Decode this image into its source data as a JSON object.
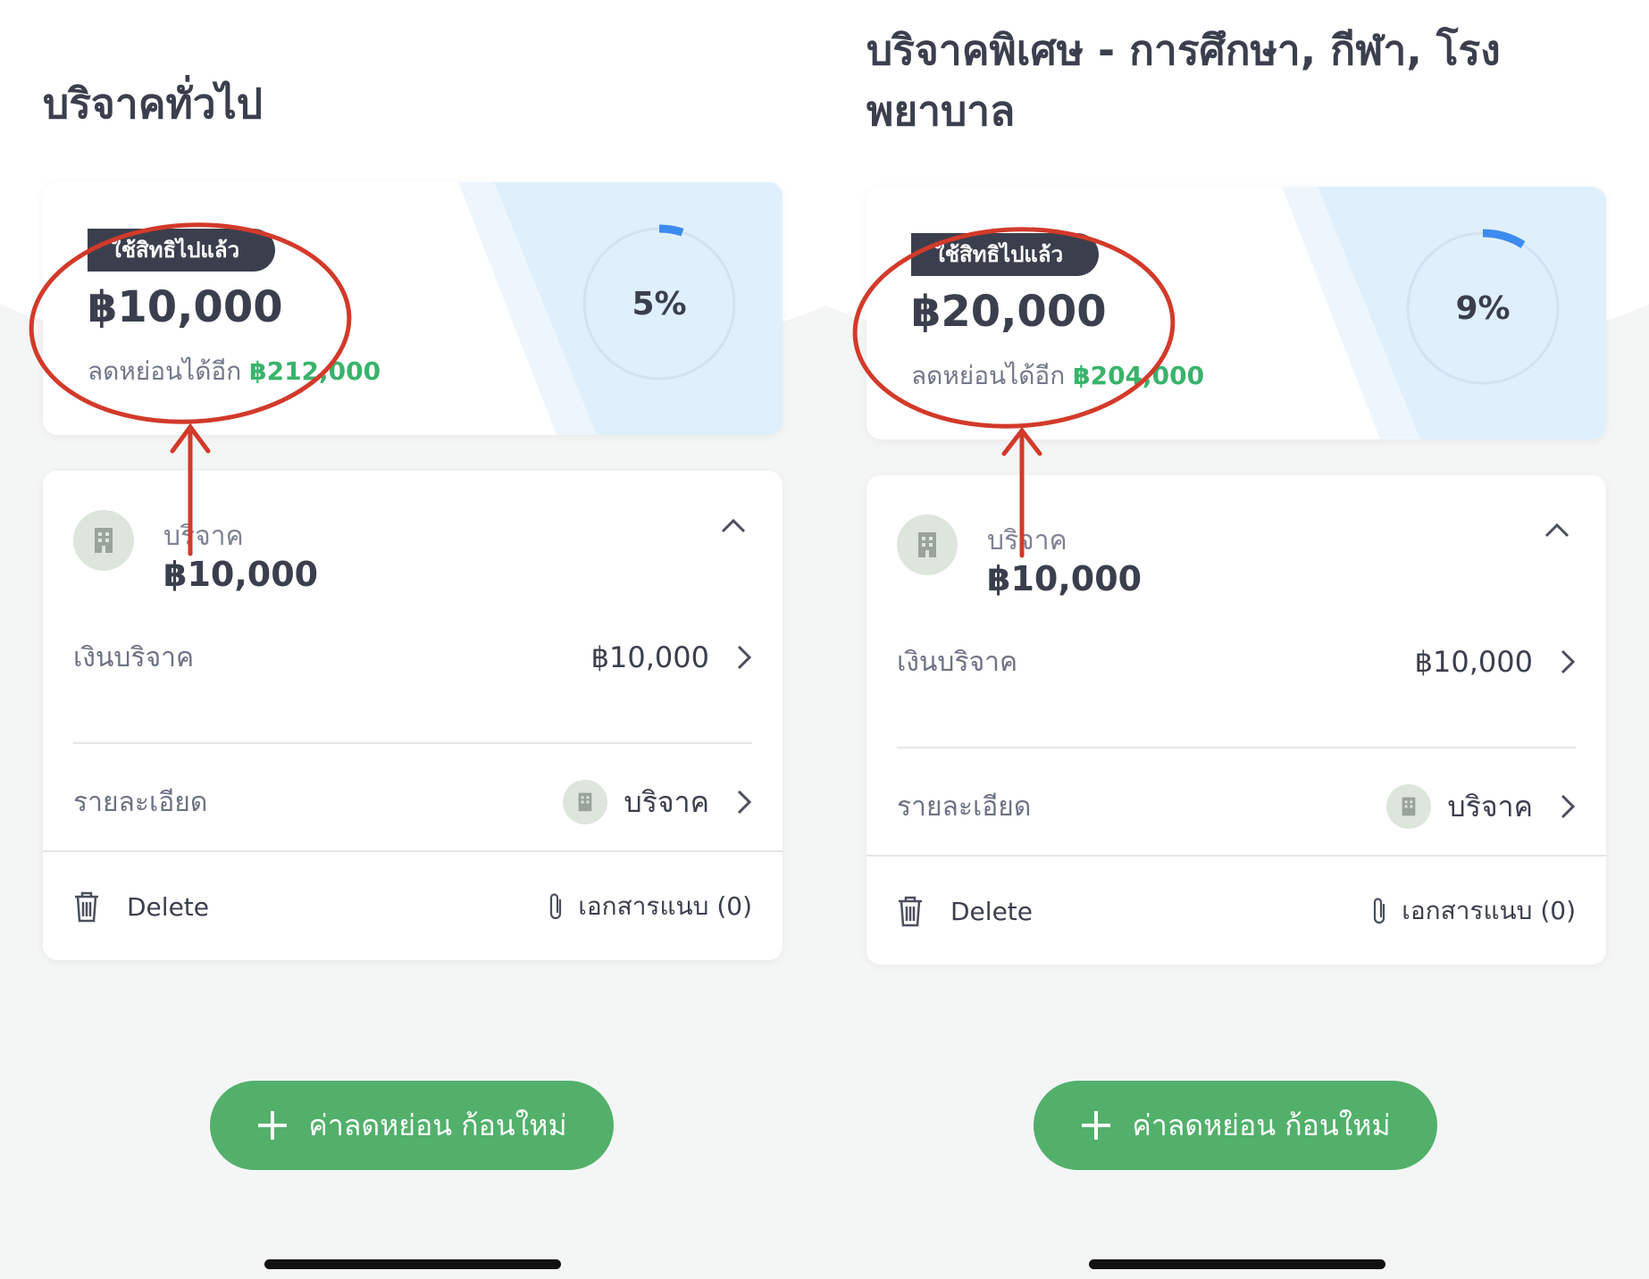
{
  "colors": {
    "accent_green": "#52b06b",
    "annotation_red": "#d23a2a",
    "progress_blue": "#3d8bf0",
    "text_dark": "#3b3f4d"
  },
  "panels": [
    {
      "title": "บริจาคทั่วไป",
      "summary": {
        "badge": "ใช้สิทธิไปแล้ว",
        "used_amount": "฿10,000",
        "remaining_label": "ลดหย่อนได้อีก",
        "remaining_amount": "฿212,000",
        "percent_label": "5%",
        "percent": 5
      },
      "detail": {
        "category_icon": "building-icon",
        "category_label": "บริจาค",
        "category_amount": "฿10,000",
        "rows": [
          {
            "label": "เงินบริจาค",
            "value": "฿10,000"
          },
          {
            "label": "รายละเอียด",
            "value": "บริจาค",
            "icon": "building-icon"
          }
        ],
        "delete_label": "Delete",
        "attach_label": "เอกสารแนบ (0)"
      },
      "add_button_label": "ค่าลดหย่อน ก้อนใหม่"
    },
    {
      "title": "บริจาคพิเศษ - การศึกษา, กีฬา, โรงพยาบาล",
      "summary": {
        "badge": "ใช้สิทธิไปแล้ว",
        "used_amount": "฿20,000",
        "remaining_label": "ลดหย่อนได้อีก",
        "remaining_amount": "฿204,000",
        "percent_label": "9%",
        "percent": 9
      },
      "detail": {
        "category_icon": "building-icon",
        "category_label": "บริจาค",
        "category_amount": "฿10,000",
        "rows": [
          {
            "label": "เงินบริจาค",
            "value": "฿10,000"
          },
          {
            "label": "รายละเอียด",
            "value": "บริจาค",
            "icon": "building-icon"
          }
        ],
        "delete_label": "Delete",
        "attach_label": "เอกสารแนบ (0)"
      },
      "add_button_label": "ค่าลดหย่อน ก้อนใหม่"
    }
  ]
}
